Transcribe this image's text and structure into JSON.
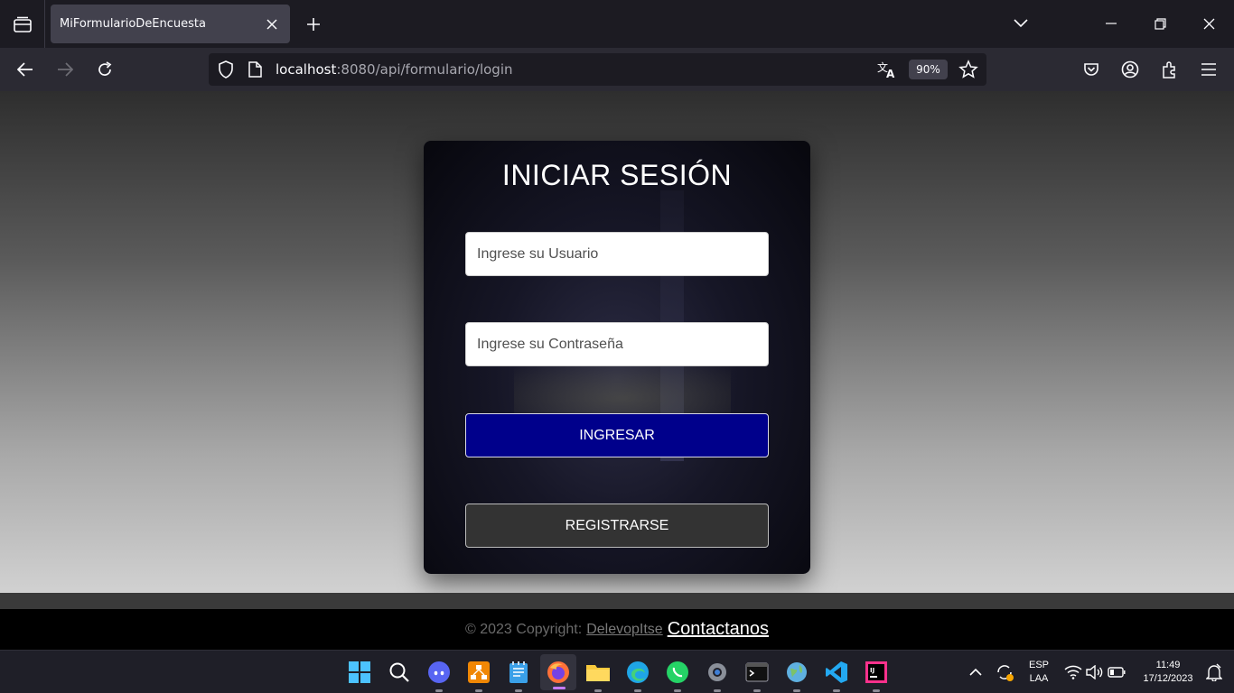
{
  "browser": {
    "tab": {
      "title": "MiFormularioDeEncuesta"
    },
    "url": {
      "host": "localhost",
      "path": ":8080/api/formulario/login"
    },
    "zoom": "90%"
  },
  "login": {
    "title": "INICIAR SESIÓN",
    "username_placeholder": "Ingrese su Usuario",
    "password_placeholder": "Ingrese su Contraseña",
    "login_button": "INGRESAR",
    "register_button": "REGISTRARSE"
  },
  "footer": {
    "copyright": "© 2023 Copyright:",
    "developer_link": "DelevopItse",
    "contact_link": "Contactanos"
  },
  "taskbar": {
    "apps": [
      "start",
      "search",
      "discord",
      "app-orange",
      "notepad",
      "firefox",
      "file-explorer",
      "edge",
      "whatsapp",
      "settings",
      "terminal",
      "app-globe",
      "vscode",
      "intellij"
    ],
    "language": "ESP",
    "keyboard": "LAA",
    "time": "11:49",
    "date": "17/12/2023"
  },
  "colors": {
    "login_button": "#00008b",
    "register_button": "#333333",
    "footer_bg": "#000000"
  }
}
